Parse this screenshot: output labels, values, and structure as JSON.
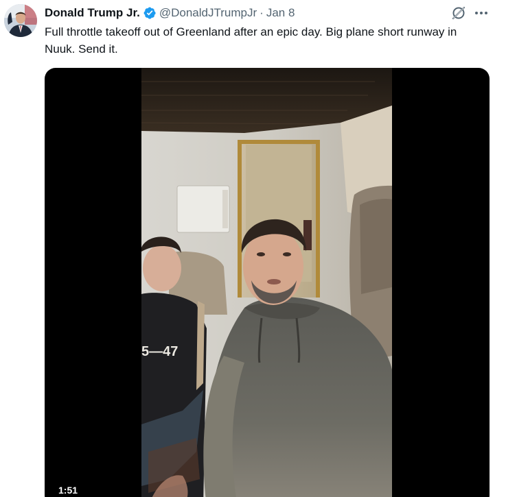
{
  "tweet": {
    "author": {
      "display_name": "Donald Trump Jr.",
      "handle": "@DonaldJTrumpJr",
      "verified": true,
      "verified_color": "#1d9bf0"
    },
    "separator": "·",
    "date": "Jan 8",
    "text": "Full throttle takeoff out of Greenland after an epic day. Big plane short runway in Nuuk. Send it.",
    "media": {
      "type": "video",
      "duration": "1:51",
      "hoodie_text": "5—47"
    },
    "icons": {
      "grok": "grok-icon",
      "more": "more-icon",
      "verified": "verified-badge-icon"
    }
  }
}
